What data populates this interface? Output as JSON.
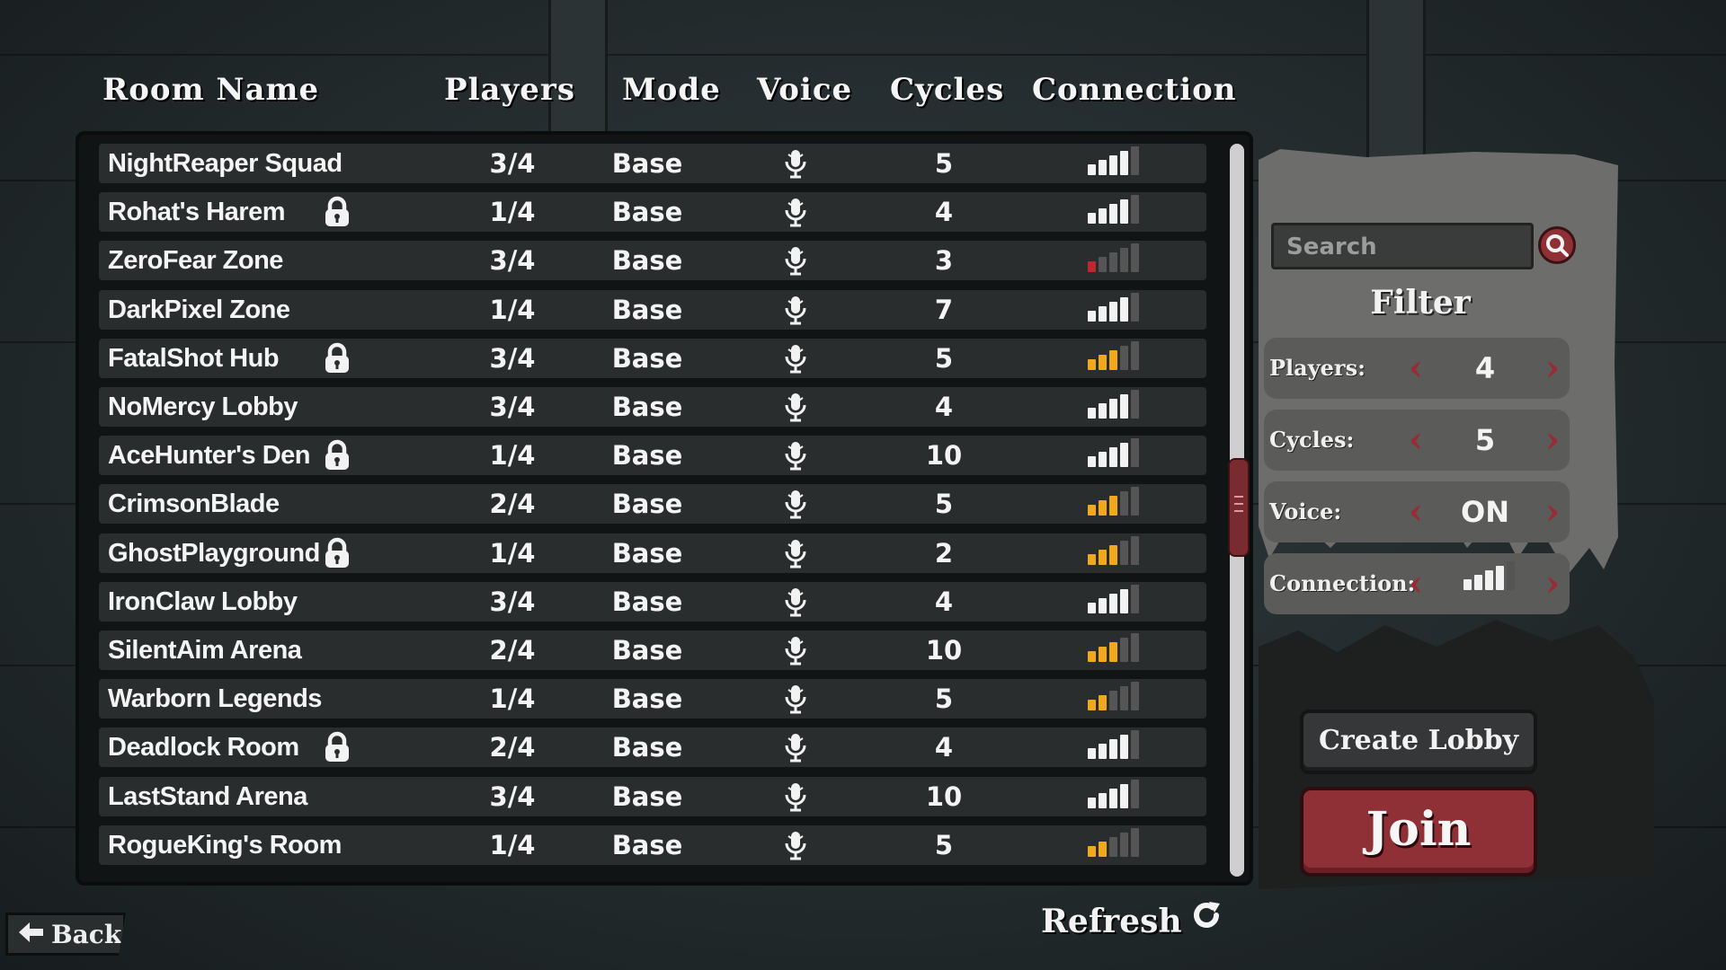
{
  "headers": {
    "room_name": "Room Name",
    "players": "Players",
    "mode": "Mode",
    "voice": "Voice",
    "cycles": "Cycles",
    "connection": "Connection"
  },
  "rooms": [
    {
      "name": "NightReaper Squad",
      "locked": false,
      "players": "3/4",
      "mode": "Base",
      "voice_icon": "microphone-icon",
      "cycles": "5",
      "connection": 4,
      "signal_color": "#f2f2f2"
    },
    {
      "name": "Rohat's Harem",
      "locked": true,
      "players": "1/4",
      "mode": "Base",
      "voice_icon": "microphone-icon",
      "cycles": "4",
      "connection": 4,
      "signal_color": "#f2f2f2"
    },
    {
      "name": "ZeroFear Zone",
      "locked": false,
      "players": "3/4",
      "mode": "Base",
      "voice_icon": "microphone-icon",
      "cycles": "3",
      "connection": 1,
      "signal_color": "#c0262e"
    },
    {
      "name": "DarkPixel Zone",
      "locked": false,
      "players": "1/4",
      "mode": "Base",
      "voice_icon": "microphone-icon",
      "cycles": "7",
      "connection": 4,
      "signal_color": "#f2f2f2"
    },
    {
      "name": "FatalShot Hub",
      "locked": true,
      "players": "3/4",
      "mode": "Base",
      "voice_icon": "microphone-icon",
      "cycles": "5",
      "connection": 3,
      "signal_color": "#f0a81c"
    },
    {
      "name": "NoMercy Lobby",
      "locked": false,
      "players": "3/4",
      "mode": "Base",
      "voice_icon": "microphone-icon",
      "cycles": "4",
      "connection": 4,
      "signal_color": "#f2f2f2"
    },
    {
      "name": "AceHunter's Den",
      "locked": true,
      "players": "1/4",
      "mode": "Base",
      "voice_icon": "microphone-icon",
      "cycles": "10",
      "connection": 4,
      "signal_color": "#f2f2f2"
    },
    {
      "name": "CrimsonBlade",
      "locked": false,
      "players": "2/4",
      "mode": "Base",
      "voice_icon": "microphone-icon",
      "cycles": "5",
      "connection": 3,
      "signal_color": "#f0a81c"
    },
    {
      "name": "GhostPlayground",
      "locked": true,
      "players": "1/4",
      "mode": "Base",
      "voice_icon": "microphone-icon",
      "cycles": "2",
      "connection": 3,
      "signal_color": "#f0a81c"
    },
    {
      "name": "IronClaw Lobby",
      "locked": false,
      "players": "3/4",
      "mode": "Base",
      "voice_icon": "microphone-icon",
      "cycles": "4",
      "connection": 4,
      "signal_color": "#f2f2f2"
    },
    {
      "name": "SilentAim Arena",
      "locked": false,
      "players": "2/4",
      "mode": "Base",
      "voice_icon": "microphone-icon",
      "cycles": "10",
      "connection": 3,
      "signal_color": "#f0a81c"
    },
    {
      "name": "Warborn Legends",
      "locked": false,
      "players": "1/4",
      "mode": "Base",
      "voice_icon": "microphone-icon",
      "cycles": "5",
      "connection": 2,
      "signal_color": "#f0a81c"
    },
    {
      "name": "Deadlock Room",
      "locked": true,
      "players": "2/4",
      "mode": "Base",
      "voice_icon": "microphone-icon",
      "cycles": "4",
      "connection": 4,
      "signal_color": "#f2f2f2"
    },
    {
      "name": "LastStand Arena",
      "locked": false,
      "players": "3/4",
      "mode": "Base",
      "voice_icon": "microphone-icon",
      "cycles": "10",
      "connection": 4,
      "signal_color": "#f2f2f2"
    },
    {
      "name": "RogueKing's Room",
      "locked": false,
      "players": "1/4",
      "mode": "Base",
      "voice_icon": "microphone-icon",
      "cycles": "5",
      "connection": 2,
      "signal_color": "#f0a81c"
    }
  ],
  "search": {
    "placeholder": "Search",
    "icon": "search-icon"
  },
  "filter": {
    "title": "Filter",
    "players": {
      "label": "Players:",
      "value": "4"
    },
    "cycles": {
      "label": "Cycles:",
      "value": "5"
    },
    "voice": {
      "label": "Voice:",
      "value": "ON"
    },
    "connection": {
      "label": "Connection:",
      "level": 4,
      "icon": "signal-icon"
    }
  },
  "buttons": {
    "create_lobby": "Create Lobby",
    "join": "Join",
    "refresh": "Refresh",
    "back": "Back"
  },
  "colors": {
    "accent_red": "#8f2f36",
    "signal_good": "#f2f2f2",
    "signal_medium": "#f0a81c",
    "signal_bad": "#c0262e",
    "signal_empty": "#555555"
  }
}
